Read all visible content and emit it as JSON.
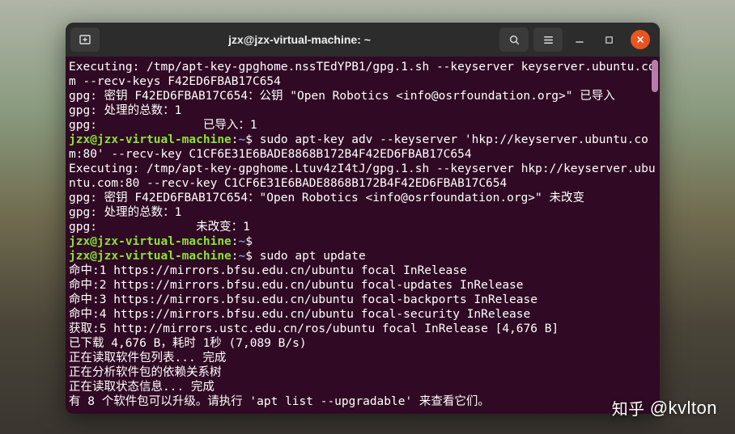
{
  "window": {
    "title": "jzx@jzx-virtual-machine: ~"
  },
  "prompt": {
    "user_host": "jzx@jzx-virtual-machine",
    "path": "~",
    "symbol": "$"
  },
  "lines": {
    "l1": "Executing: /tmp/apt-key-gpghome.nssTEdYPB1/gpg.1.sh --keyserver keyserver.ubuntu.com --recv-keys F42ED6FBAB17C654",
    "l2": "gpg: 密钥 F42ED6FBAB17C654：公钥 \"Open Robotics <info@osrfoundation.org>\" 已导入",
    "l3": "gpg: 处理的总数：1",
    "l4": "gpg:               已导入：1",
    "cmd1": " sudo apt-key adv --keyserver 'hkp://keyserver.ubuntu.com:80' --recv-key C1CF6E31E6BADE8868B172B4F42ED6FBAB17C654",
    "l5": "Executing: /tmp/apt-key-gpghome.Ltuv4zI4tJ/gpg.1.sh --keyserver hkp://keyserver.ubuntu.com:80 --recv-key C1CF6E31E6BADE8868B172B4F42ED6FBAB17C654",
    "l6": "gpg: 密钥 F42ED6FBAB17C654：\"Open Robotics <info@osrfoundation.org>\" 未改变",
    "l7": "gpg: 处理的总数：1",
    "l8": "gpg:              未改变：1",
    "cmd2": "",
    "cmd3": " sudo apt update",
    "l9": "命中:1 https://mirrors.bfsu.edu.cn/ubuntu focal InRelease",
    "l10": "命中:2 https://mirrors.bfsu.edu.cn/ubuntu focal-updates InRelease",
    "l11": "命中:3 https://mirrors.bfsu.edu.cn/ubuntu focal-backports InRelease",
    "l12": "命中:4 https://mirrors.bfsu.edu.cn/ubuntu focal-security InRelease",
    "l13": "获取:5 http://mirrors.ustc.edu.cn/ros/ubuntu focal InRelease [4,676 B]",
    "l14": "已下载 4,676 B，耗时 1秒 (7,089 B/s)",
    "l15": "正在读取软件包列表... 完成",
    "l16": "正在分析软件包的依赖关系树",
    "l17": "正在读取状态信息... 完成",
    "l18": "有 8 个软件包可以升级。请执行 'apt list --upgradable' 来查看它们。"
  },
  "watermark": {
    "brand": "知乎",
    "at": "@kvlton"
  }
}
